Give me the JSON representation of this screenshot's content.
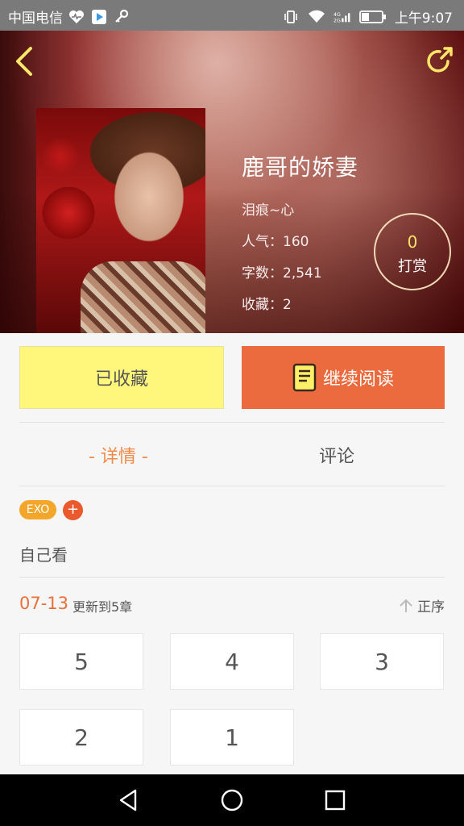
{
  "status_bar": {
    "carrier": "中国电信",
    "time": "上午9:07"
  },
  "header": {
    "back_icon": "chevron-left-icon",
    "share_icon": "refresh-share-icon"
  },
  "book": {
    "title": "鹿哥的娇妻",
    "author": "泪痕~心",
    "popularity": "人气：160",
    "word_count": "字数：2,541",
    "favorites": "收藏：2",
    "tip_count": "0",
    "tip_label": "打赏"
  },
  "actions": {
    "collected_label": "已收藏",
    "continue_label": "继续阅读"
  },
  "tabs": [
    {
      "label": "- 详情 -",
      "active": true
    },
    {
      "label": "评论",
      "active": false
    }
  ],
  "tags": {
    "items": [
      "EXO"
    ],
    "add_label": "+"
  },
  "description": "自己看",
  "update": {
    "date": "07-13",
    "text": "更新到5章",
    "sort_label": "正序"
  },
  "chapters": [
    "5",
    "4",
    "3",
    "2",
    "1"
  ],
  "colors": {
    "accent_orange": "#ec6b3e",
    "collect_yellow": "#fff67c",
    "tag_orange": "#f4a62a"
  }
}
